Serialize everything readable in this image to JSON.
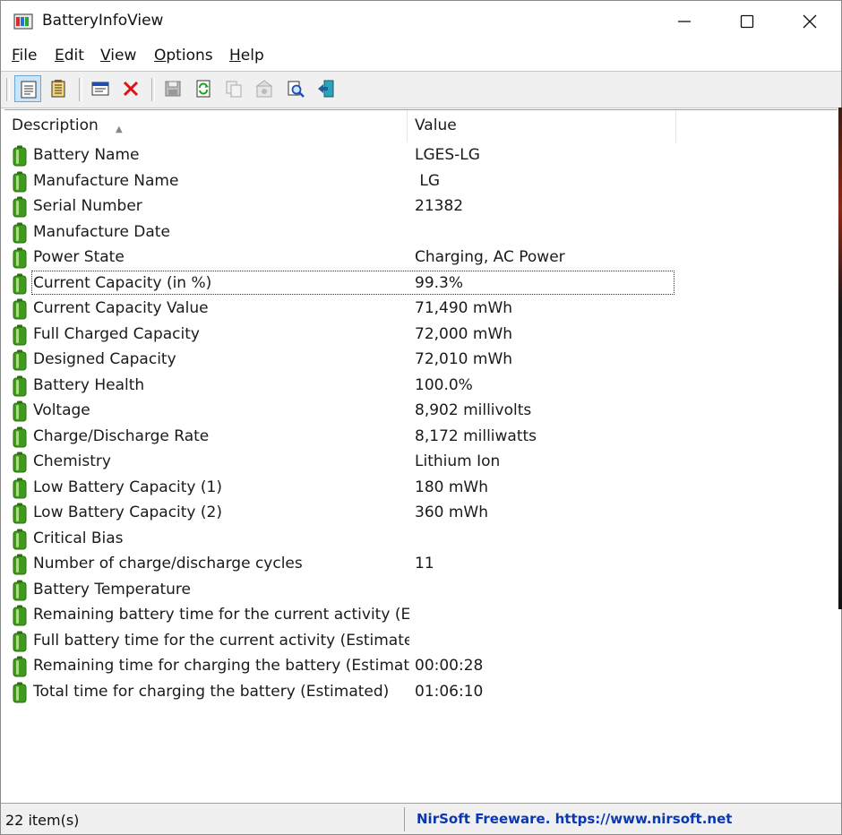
{
  "window": {
    "title": "BatteryInfoView",
    "minimize_label": "",
    "maximize_label": "",
    "close_label": ""
  },
  "menu": [
    "File",
    "Edit",
    "View",
    "Options",
    "Help"
  ],
  "toolbar": {
    "buttons": [
      {
        "icon": "html-report-icon",
        "active": true
      },
      {
        "icon": "battery-log-icon",
        "active": false
      },
      {
        "icon": "properties-window-icon",
        "active": false
      },
      {
        "icon": "delete-x-icon",
        "active": false
      },
      {
        "icon": "save-disk-icon",
        "active": false
      },
      {
        "icon": "refresh-icon",
        "active": false
      },
      {
        "icon": "copy-icon",
        "active": false
      },
      {
        "icon": "properties-icon",
        "active": false
      },
      {
        "icon": "find-icon",
        "active": false
      },
      {
        "icon": "exit-icon",
        "active": false
      }
    ]
  },
  "list": {
    "columns": [
      "Description",
      "Value"
    ],
    "rows": [
      {
        "description": "Battery Name",
        "value": "LGES-LG"
      },
      {
        "description": "Manufacture Name",
        "value": " LG"
      },
      {
        "description": "Serial Number",
        "value": "21382"
      },
      {
        "description": "Manufacture Date",
        "value": ""
      },
      {
        "description": "Power State",
        "value": "Charging, AC Power"
      },
      {
        "description": "Current Capacity (in %)",
        "value": "99.3%",
        "focused": true
      },
      {
        "description": "Current Capacity Value",
        "value": "71,490 mWh"
      },
      {
        "description": "Full Charged Capacity",
        "value": "72,000 mWh"
      },
      {
        "description": "Designed Capacity",
        "value": "72,010 mWh"
      },
      {
        "description": "Battery Health",
        "value": "100.0%"
      },
      {
        "description": "Voltage",
        "value": "8,902 millivolts"
      },
      {
        "description": "Charge/Discharge Rate",
        "value": "8,172 milliwatts"
      },
      {
        "description": "Chemistry",
        "value": "Lithium Ion"
      },
      {
        "description": "Low Battery Capacity (1)",
        "value": "180 mWh"
      },
      {
        "description": "Low Battery Capacity (2)",
        "value": "360 mWh"
      },
      {
        "description": "Critical Bias",
        "value": ""
      },
      {
        "description": "Number of charge/discharge cycles",
        "value": "11"
      },
      {
        "description": "Battery Temperature",
        "value": ""
      },
      {
        "description": "Remaining battery time for the current activity (E...",
        "value": ""
      },
      {
        "description": "Full battery time for the current activity (Estimated)",
        "value": ""
      },
      {
        "description": "Remaining time for charging the battery (Estimat...",
        "value": "00:00:28"
      },
      {
        "description": "Total  time for charging the battery (Estimated)",
        "value": "01:06:10"
      }
    ]
  },
  "status": {
    "item_count": "22 item(s)",
    "link": "NirSoft Freeware. https://www.nirsoft.net"
  },
  "colors": {
    "battery_green": "#3f9a1e",
    "link_blue": "#0b38b0",
    "toolbar_bg": "#f0f0f0"
  }
}
